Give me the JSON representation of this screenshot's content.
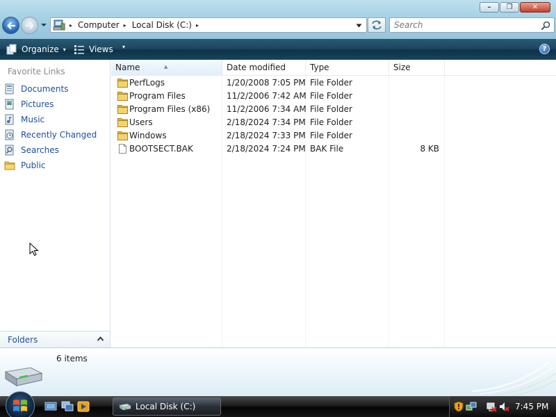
{
  "window": {
    "controls": {
      "minimize": "–",
      "maximize": "❐",
      "close": "✕"
    }
  },
  "nav": {
    "back_icon": "back-arrow-icon",
    "forward_icon": "forward-arrow-icon"
  },
  "address": {
    "icon": "computer-icon",
    "crumbs": [
      "Computer",
      "Local Disk (C:)"
    ],
    "separator": "▸"
  },
  "search": {
    "placeholder": "Search",
    "icon": "magnifier-icon"
  },
  "toolbar": {
    "organize_label": "Organize",
    "views_label": "Views",
    "dropdown_glyph": "▾",
    "help_glyph": "?"
  },
  "nav_pane": {
    "heading": "Favorite Links",
    "links": [
      {
        "label": "Documents",
        "icon": "documents-icon"
      },
      {
        "label": "Pictures",
        "icon": "pictures-icon"
      },
      {
        "label": "Music",
        "icon": "music-icon"
      },
      {
        "label": "Recently Changed",
        "icon": "recently-changed-icon"
      },
      {
        "label": "Searches",
        "icon": "searches-icon"
      },
      {
        "label": "Public",
        "icon": "public-folder-icon"
      }
    ],
    "folders_label": "Folders"
  },
  "file_list": {
    "columns": [
      "Name",
      "Date modified",
      "Type",
      "Size"
    ],
    "sorted_column": "Name",
    "rows": [
      {
        "name": "PerfLogs",
        "date": "1/20/2008 7:05 PM",
        "type": "File Folder",
        "size": "",
        "icon": "folder-icon"
      },
      {
        "name": "Program Files",
        "date": "11/2/2006 7:42 AM",
        "type": "File Folder",
        "size": "",
        "icon": "folder-icon"
      },
      {
        "name": "Program Files (x86)",
        "date": "11/2/2006 7:34 AM",
        "type": "File Folder",
        "size": "",
        "icon": "folder-icon"
      },
      {
        "name": "Users",
        "date": "2/18/2024 7:34 PM",
        "type": "File Folder",
        "size": "",
        "icon": "folder-icon"
      },
      {
        "name": "Windows",
        "date": "2/18/2024 7:33 PM",
        "type": "File Folder",
        "size": "",
        "icon": "folder-icon"
      },
      {
        "name": "BOOTSECT.BAK",
        "date": "2/18/2024 7:24 PM",
        "type": "BAK File",
        "size": "8 KB",
        "icon": "file-icon"
      }
    ]
  },
  "details": {
    "item_count": "6 items",
    "icon": "hard-drive-icon"
  },
  "taskbar": {
    "task_label": "Local Disk (C:)",
    "clock": "7:45 PM",
    "quick_launch": [
      "show-desktop-icon",
      "switch-windows-icon",
      "media-player-icon"
    ],
    "tray": [
      "security-shield-icon",
      "network-icon",
      "power-icon",
      "volume-muted-icon"
    ]
  },
  "colors": {
    "link": "#1c4fa0",
    "toolbar": "#17445c",
    "address_bar": "#a8d2e6"
  }
}
